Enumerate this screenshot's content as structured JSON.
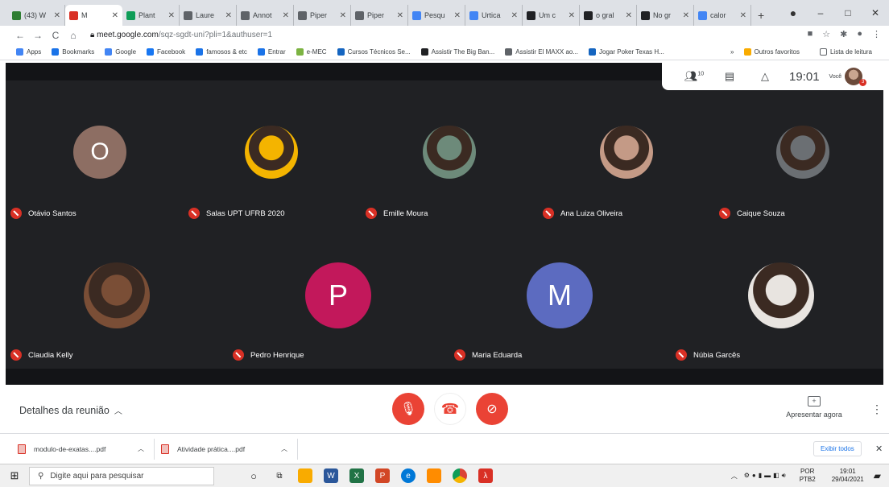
{
  "browser": {
    "tabs": [
      {
        "label": "(43) W",
        "color": "#2e7d32"
      },
      {
        "label": "M",
        "color": "#d93025",
        "active": true
      },
      {
        "label": "Plant",
        "color": "#0f9d58"
      },
      {
        "label": "Laure",
        "color": "#5f6368"
      },
      {
        "label": "Annot",
        "color": "#5f6368"
      },
      {
        "label": "Piper",
        "color": "#5f6368"
      },
      {
        "label": "Piper",
        "color": "#5f6368"
      },
      {
        "label": "Pesqu",
        "color": "#4285f4"
      },
      {
        "label": "Urtica",
        "color": "#4285f4"
      },
      {
        "label": "Um c",
        "color": "#202124"
      },
      {
        "label": "o gral",
        "color": "#202124"
      },
      {
        "label": "No gr",
        "color": "#202124"
      },
      {
        "label": "calor",
        "color": "#4285f4"
      }
    ],
    "new_tab": "+",
    "window_controls": [
      "–",
      "□",
      "✕"
    ],
    "url_host": "meet.google.com",
    "url_path": "/sqz-sgdt-uni?pli=1&authuser=1",
    "bookmarks": [
      {
        "label": "Apps",
        "color": "#4285f4"
      },
      {
        "label": "Bookmarks",
        "color": "#1a73e8"
      },
      {
        "label": "Google",
        "color": "#4285f4"
      },
      {
        "label": "Facebook",
        "color": "#1877f2"
      },
      {
        "label": "famosos & etc",
        "color": "#1a73e8"
      },
      {
        "label": "Entrar",
        "color": "#1a73e8"
      },
      {
        "label": "e-MEC",
        "color": "#7cb342"
      },
      {
        "label": "Cursos Técnicos Se...",
        "color": "#1565c0"
      },
      {
        "label": "Assistir The Big Ban...",
        "color": "#202124"
      },
      {
        "label": "Assistir El MAXX ao...",
        "color": "#5f6368"
      },
      {
        "label": "Jogar Poker Texas H...",
        "color": "#1565c0"
      }
    ],
    "bookmarks_more": "»",
    "other_favorites": "Outros favoritos",
    "reading_list": "Lista de leitura"
  },
  "meet": {
    "participant_count": "10",
    "time": "19:01",
    "self_label": "Você",
    "self_badge": "3",
    "participants": [
      {
        "name": "Otávio Santos",
        "initial": "O",
        "color": "#8d6e63",
        "photo": false
      },
      {
        "name": "Salas UPT UFRB 2020",
        "initial": "",
        "color": "#f4b400",
        "photo": true
      },
      {
        "name": "Emille Moura",
        "initial": "",
        "color": "#6d8a7a",
        "photo": true
      },
      {
        "name": "Ana Luiza Oliveira",
        "initial": "",
        "color": "#c49a86",
        "photo": true
      },
      {
        "name": "Caique Souza",
        "initial": "",
        "color": "#6b6f73",
        "photo": true
      },
      {
        "name": "Claudia Kelly",
        "initial": "",
        "color": "#7a4e36",
        "photo": true
      },
      {
        "name": "Pedro Henrique",
        "initial": "P",
        "color": "#c2185b",
        "photo": false
      },
      {
        "name": "Maria Eduarda",
        "initial": "M",
        "color": "#5c6bc0",
        "photo": false
      },
      {
        "name": "Núbia Garcês",
        "initial": "",
        "color": "#e8e4e0",
        "photo": true
      }
    ],
    "details_label": "Detalhes da reunião",
    "present_label": "Apresentar agora"
  },
  "downloads": [
    {
      "name": "modulo-de-exatas....pdf"
    },
    {
      "name": "Atividade prática....pdf"
    }
  ],
  "downloads_show_all": "Exibir todos",
  "taskbar": {
    "search_placeholder": "Digite aqui para pesquisar",
    "lang_top": "POR",
    "lang_bottom": "PTB2",
    "clock_time": "19:01",
    "clock_date": "29/04/2021"
  }
}
